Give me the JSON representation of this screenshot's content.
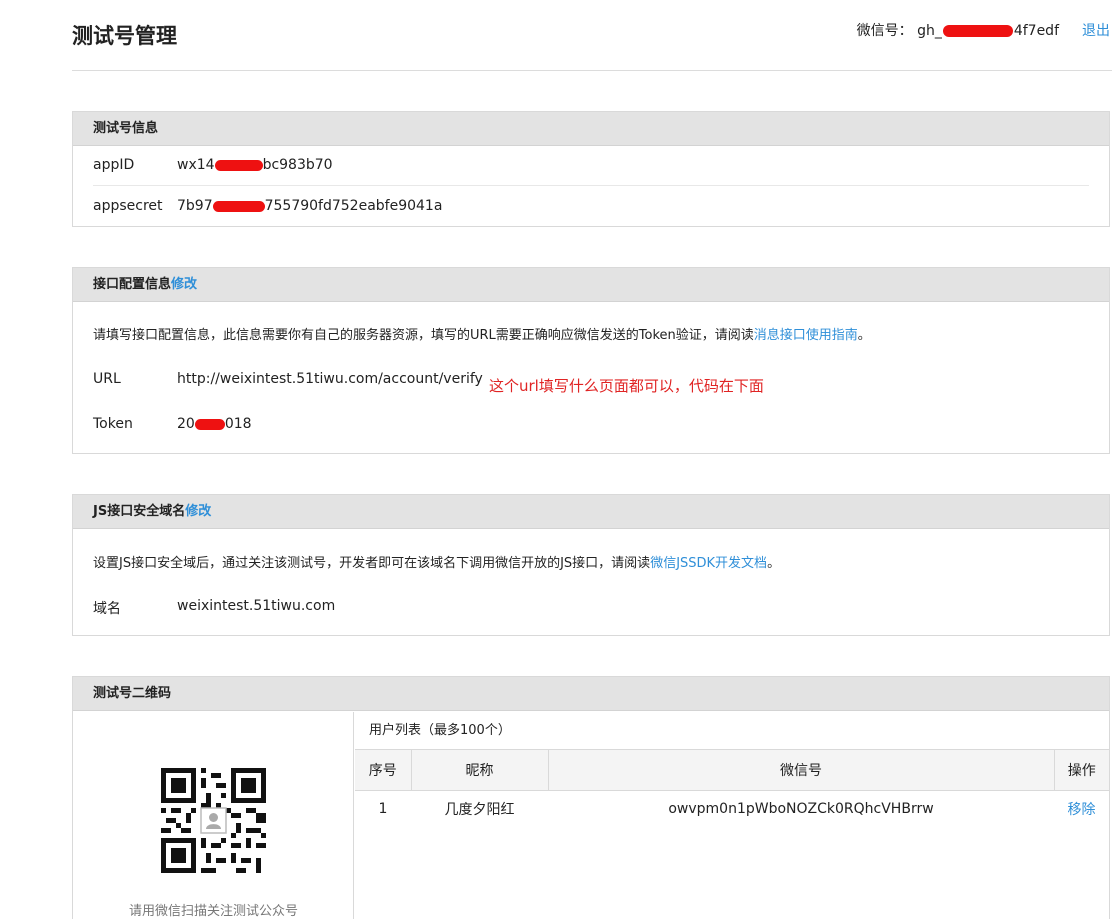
{
  "header": {
    "title": "测试号管理",
    "account_label": "微信号：",
    "account_prefix": "gh_",
    "account_suffix": "4f7edf",
    "logout": "退出"
  },
  "test_info": {
    "title": "测试号信息",
    "appid_label": "appID",
    "appid_prefix": "wx14",
    "appid_suffix": "bc983b70",
    "secret_label": "appsecret",
    "secret_prefix": "7b97",
    "secret_suffix": "755790fd752eabfe9041a"
  },
  "interface": {
    "title": "接口配置信息",
    "edit": "修改",
    "desc": "请填写接口配置信息，此信息需要你有自己的服务器资源，填写的URL需要正确响应微信发送的Token验证，请阅读",
    "desc_link": "消息接口使用指南",
    "desc_end": "。",
    "url_label": "URL",
    "url_value": "http://weixintest.51tiwu.com/account/verify",
    "annotation": "这个url填写什么页面都可以，代码在下面",
    "token_label": "Token",
    "token_prefix": "20",
    "token_suffix": "018"
  },
  "js_domain": {
    "title": "JS接口安全域名",
    "edit": "修改",
    "desc": "设置JS接口安全域后，通过关注该测试号，开发者即可在该域名下调用微信开放的JS接口，请阅读",
    "desc_link": "微信JSSDK开发文档",
    "desc_end": "。",
    "domain_label": "域名",
    "domain_value": "weixintest.51tiwu.com"
  },
  "qrcode": {
    "title": "测试号二维码",
    "caption": "请用微信扫描关注测试公众号",
    "user_list_title": "用户列表（最多100个）",
    "columns": [
      "序号",
      "昵称",
      "微信号",
      "操作"
    ],
    "rows": [
      {
        "index": "1",
        "nickname": "几度夕阳红",
        "wechat_id": "owvpm0n1pWboNOZCk0RQhcVHBrrw",
        "action": "移除"
      }
    ]
  }
}
